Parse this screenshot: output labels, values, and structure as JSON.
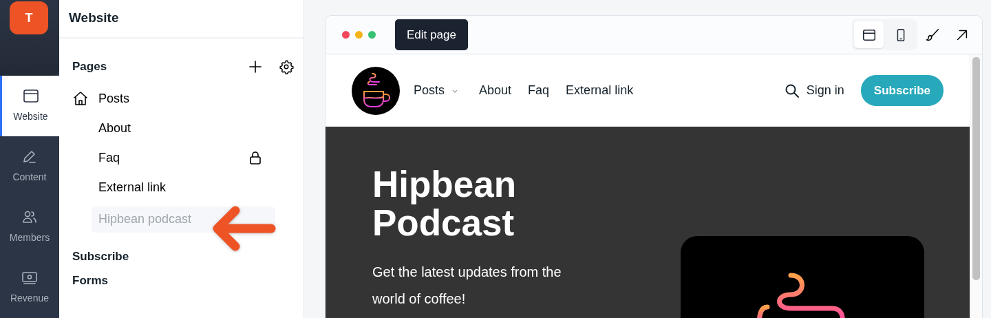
{
  "rail": {
    "logo": "T",
    "items": [
      {
        "label": "Website",
        "kind": "website",
        "selected": true
      },
      {
        "label": "Content",
        "kind": "content",
        "selected": false
      },
      {
        "label": "Members",
        "kind": "members",
        "selected": false
      },
      {
        "label": "Revenue",
        "kind": "revenue",
        "selected": false
      }
    ]
  },
  "panel": {
    "title": "Website",
    "pages_heading": "Pages",
    "pages": [
      {
        "label": "Posts",
        "home": true,
        "locked": false,
        "selected": false,
        "disabled": false
      },
      {
        "label": "About",
        "home": false,
        "locked": false,
        "selected": false,
        "disabled": false
      },
      {
        "label": "Faq",
        "home": false,
        "locked": true,
        "selected": false,
        "disabled": false
      },
      {
        "label": "External link",
        "home": false,
        "locked": false,
        "selected": false,
        "disabled": false
      },
      {
        "label": "Hipbean podcast",
        "home": false,
        "locked": false,
        "selected": true,
        "disabled": true
      }
    ],
    "sections": [
      "Subscribe",
      "Forms"
    ]
  },
  "preview": {
    "edit_button": "Edit page",
    "views": [
      {
        "kind": "desktop",
        "selected": true
      },
      {
        "kind": "mobile",
        "selected": false
      }
    ],
    "site": {
      "nav": [
        {
          "label": "Posts",
          "dropdown": true
        },
        {
          "label": "About",
          "dropdown": false
        },
        {
          "label": "Faq",
          "dropdown": false
        },
        {
          "label": "External link",
          "dropdown": false
        }
      ],
      "sign_in": "Sign in",
      "subscribe": "Subscribe",
      "hero": {
        "title": "Hipbean Podcast",
        "subtitle": "Get the latest updates from the world of coffee!"
      }
    }
  }
}
